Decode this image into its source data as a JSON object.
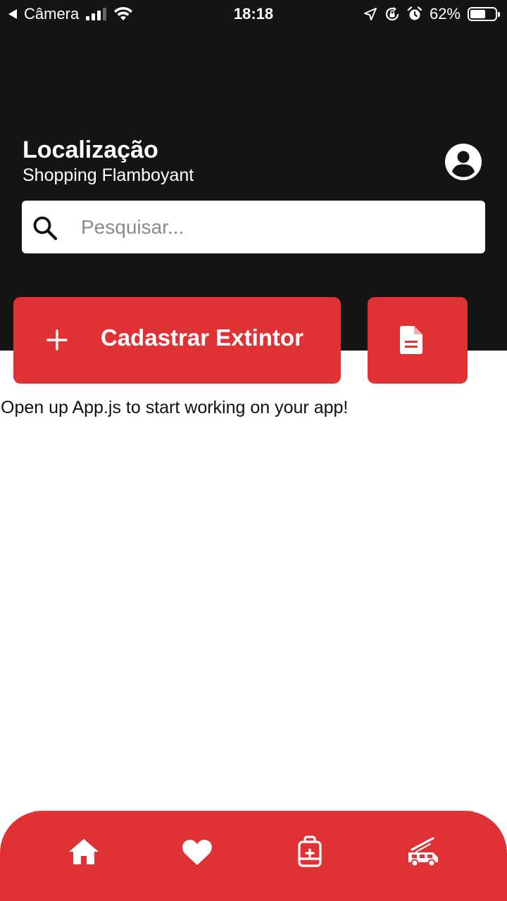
{
  "status_bar": {
    "back_label": "Câmera",
    "time": "18:18",
    "battery_percent": "62%",
    "battery_level": 0.62
  },
  "header": {
    "location_label": "Localização",
    "location_name": "Shopping Flamboyant"
  },
  "search": {
    "placeholder": "Pesquisar..."
  },
  "actions": {
    "register_label": "Cadastrar Extintor"
  },
  "main": {
    "message": "Open up App.js to start working on your app!"
  },
  "colors": {
    "header_bg": "#141415",
    "accent": "#e03235",
    "text_light": "#ffffff"
  },
  "icons": {
    "tabs": [
      "home-icon",
      "heart-icon",
      "first-aid-kit-icon",
      "fire-truck-icon"
    ],
    "header": [
      "user-circle-icon",
      "search-icon"
    ],
    "actions": [
      "plus-icon",
      "document-icon"
    ]
  }
}
